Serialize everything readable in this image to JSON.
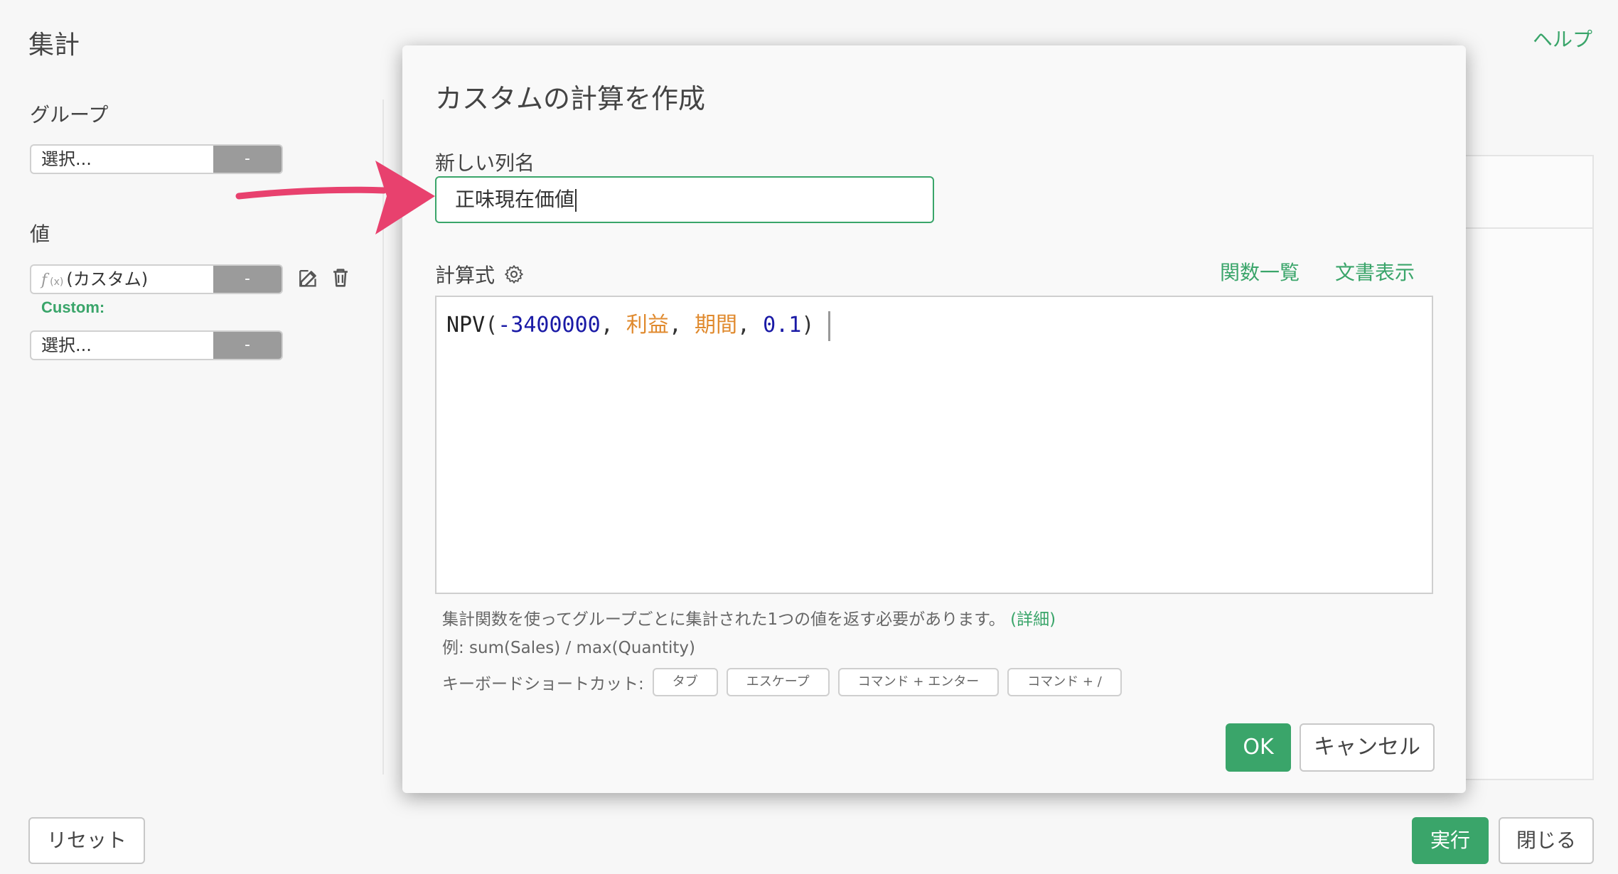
{
  "page": {
    "title": "集計",
    "help_link": "ヘルプ"
  },
  "left_panel": {
    "group_label": "グループ",
    "group_select": {
      "value": "選択...",
      "button": "-"
    },
    "value_label": "値",
    "value_select": {
      "fx_mark": "f",
      "fx_sub": "(x)",
      "value": "(カスタム)",
      "button": "-"
    },
    "custom_label": "Custom:",
    "value_select_2": {
      "value": "選択...",
      "button": "-"
    }
  },
  "footer": {
    "reset": "リセット",
    "run": "実行",
    "close": "閉じる"
  },
  "modal": {
    "title": "カスタムの計算を作成",
    "column_name_label": "新しい列名",
    "column_name_value": "正味現在価値",
    "formula_label": "計算式",
    "functions_link": "関数一覧",
    "docs_link": "文書表示",
    "formula_tokens": {
      "fn": "NPV",
      "open": "(",
      "num1": "-3400000",
      "sep1": ", ",
      "col1": "利益",
      "sep2": ", ",
      "col2": "期間",
      "sep3": ", ",
      "num2": "0.1",
      "close": ")"
    },
    "hint_text": "集計関数を使ってグループごとに集計された1つの値を返す必要があります。",
    "hint_detail": "(詳細)",
    "example_text": "例: sum(Sales) / max(Quantity)",
    "shortcut_label": "キーボードショートカット:",
    "shortcuts": [
      "タブ",
      "エスケープ",
      "コマンド + エンター",
      "コマンド + /"
    ],
    "ok": "OK",
    "cancel": "キャンセル"
  },
  "colors": {
    "accent": "#3aa56a",
    "arrow": "#e8416e",
    "button_gray": "#9b9b9b"
  }
}
